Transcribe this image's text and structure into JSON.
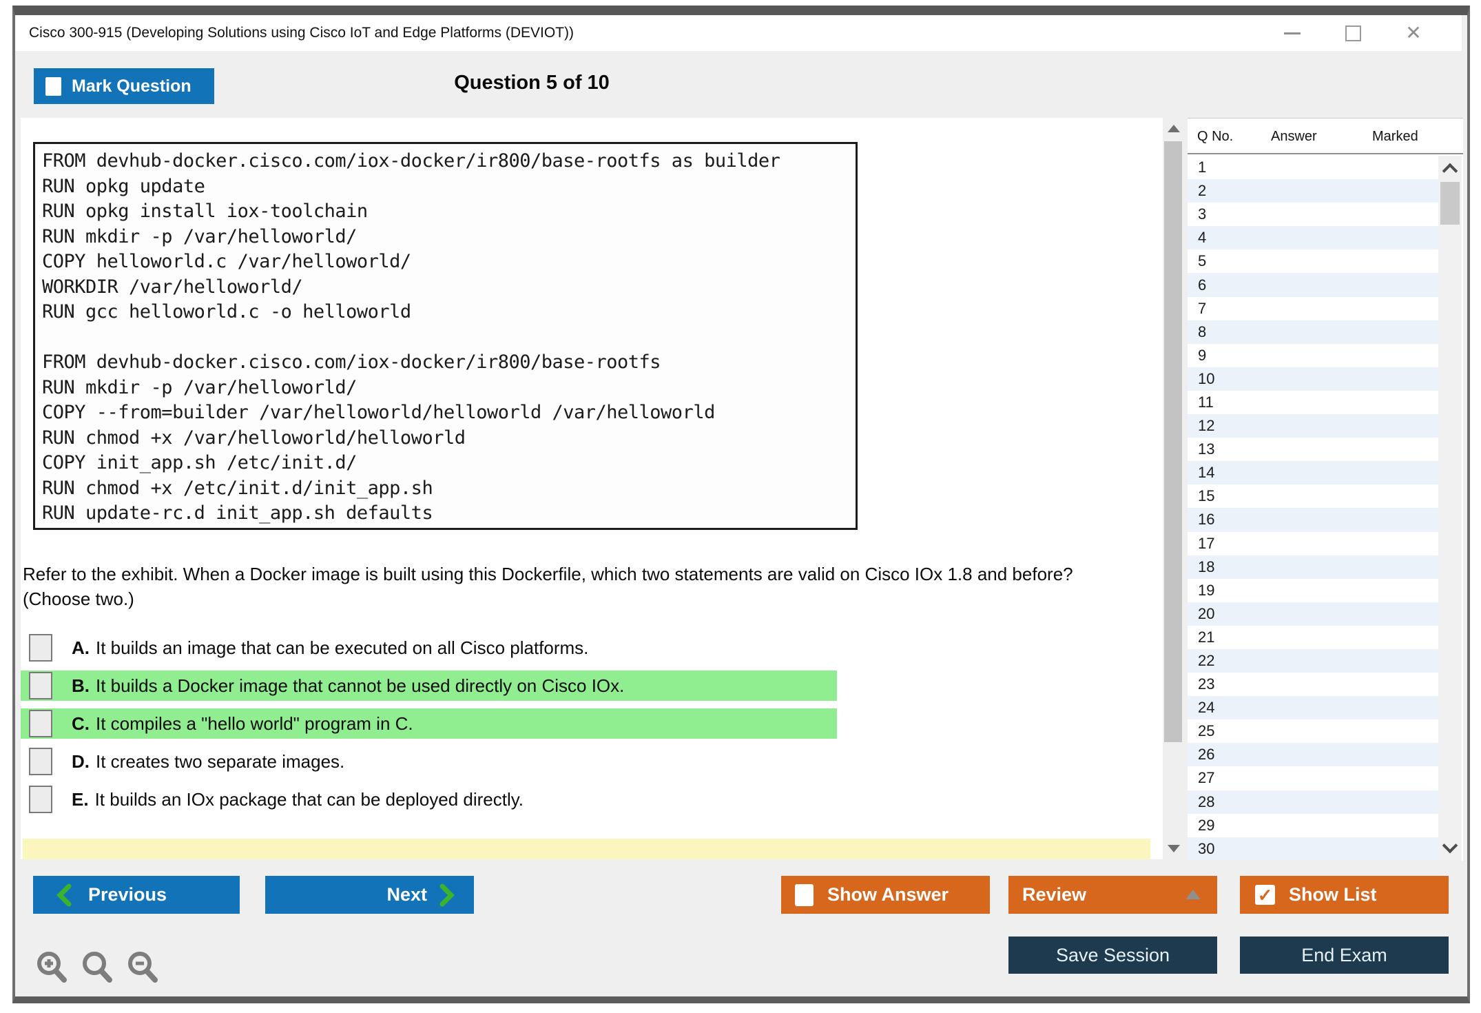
{
  "window": {
    "title": "Cisco 300-915 (Developing Solutions using Cisco IoT and Edge Platforms (DEVIOT))",
    "controls": {
      "minimize_icon": "minimize-line",
      "maximize_icon": "maximize-square",
      "close_icon": "✕"
    }
  },
  "header": {
    "mark_question_label": "Mark Question",
    "question_counter": "Question 5 of 10"
  },
  "exhibit": {
    "lines": [
      "FROM devhub-docker.cisco.com/iox-docker/ir800/base-rootfs as builder",
      "RUN opkg update",
      "RUN opkg install iox-toolchain",
      "RUN mkdir -p /var/helloworld/",
      "COPY helloworld.c /var/helloworld/",
      "WORKDIR /var/helloworld/",
      "RUN gcc helloworld.c -o helloworld",
      "",
      "FROM devhub-docker.cisco.com/iox-docker/ir800/base-rootfs",
      "RUN mkdir -p /var/helloworld/",
      "COPY --from=builder /var/helloworld/helloworld /var/helloworld",
      "RUN chmod +x /var/helloworld/helloworld",
      "COPY init_app.sh /etc/init.d/",
      "RUN chmod +x /etc/init.d/init_app.sh",
      "RUN update-rc.d init_app.sh defaults"
    ]
  },
  "question": {
    "text": "Refer to the exhibit. When a Docker image is built using this Dockerfile, which two statements are valid on Cisco IOx 1.8 and before? (Choose two.)"
  },
  "options": [
    {
      "letter": "A.",
      "text": "It builds an image that can be executed on all Cisco platforms.",
      "state": ""
    },
    {
      "letter": "B.",
      "text": "It builds a Docker image that cannot be used directly on Cisco IOx.",
      "state": "highlight"
    },
    {
      "letter": "C.",
      "text": "It compiles a \"hello world\" program in C.",
      "state": "highlight"
    },
    {
      "letter": "D.",
      "text": "It creates two separate images.",
      "state": ""
    },
    {
      "letter": "E.",
      "text": "It builds an IOx package that can be deployed directly.",
      "state": ""
    }
  ],
  "question_list": {
    "headers": [
      "Q No.",
      "Answer",
      "Marked"
    ],
    "rows": [
      "1",
      "2",
      "3",
      "4",
      "5",
      "6",
      "7",
      "8",
      "9",
      "10",
      "11",
      "12",
      "13",
      "14",
      "15",
      "16",
      "17",
      "18",
      "19",
      "20",
      "21",
      "22",
      "23",
      "24",
      "25",
      "26",
      "27",
      "28",
      "29",
      "30"
    ]
  },
  "footer": {
    "previous_label": "Previous",
    "next_label": "Next",
    "show_answer_label": "Show Answer",
    "review_label": "Review",
    "show_list_label": "Show List",
    "save_session_label": "Save Session",
    "end_exam_label": "End Exam",
    "show_list_check_glyph": "✓"
  },
  "icons": {
    "previous_chevron": "chevron-left-green",
    "next_chevron": "chevron-right-green",
    "review_caret": "triangle-up-gray",
    "zoom_in": "magnifier-plus",
    "zoom_reset": "magnifier",
    "zoom_out": "magnifier-minus",
    "scroll_arrows": "triangle-up/triangle-down",
    "list_scroll_arrows": "chevron-up/chevron-down"
  },
  "colors": {
    "accent_blue": "#1273b8",
    "accent_orange": "#d8671e",
    "navy": "#1e3a4e",
    "answer_highlight_green": "#90ee90",
    "row_alt_blue": "#ebf2f9",
    "partial_row_yellow": "#faf6bd",
    "chevron_green": "#3cb32c"
  }
}
